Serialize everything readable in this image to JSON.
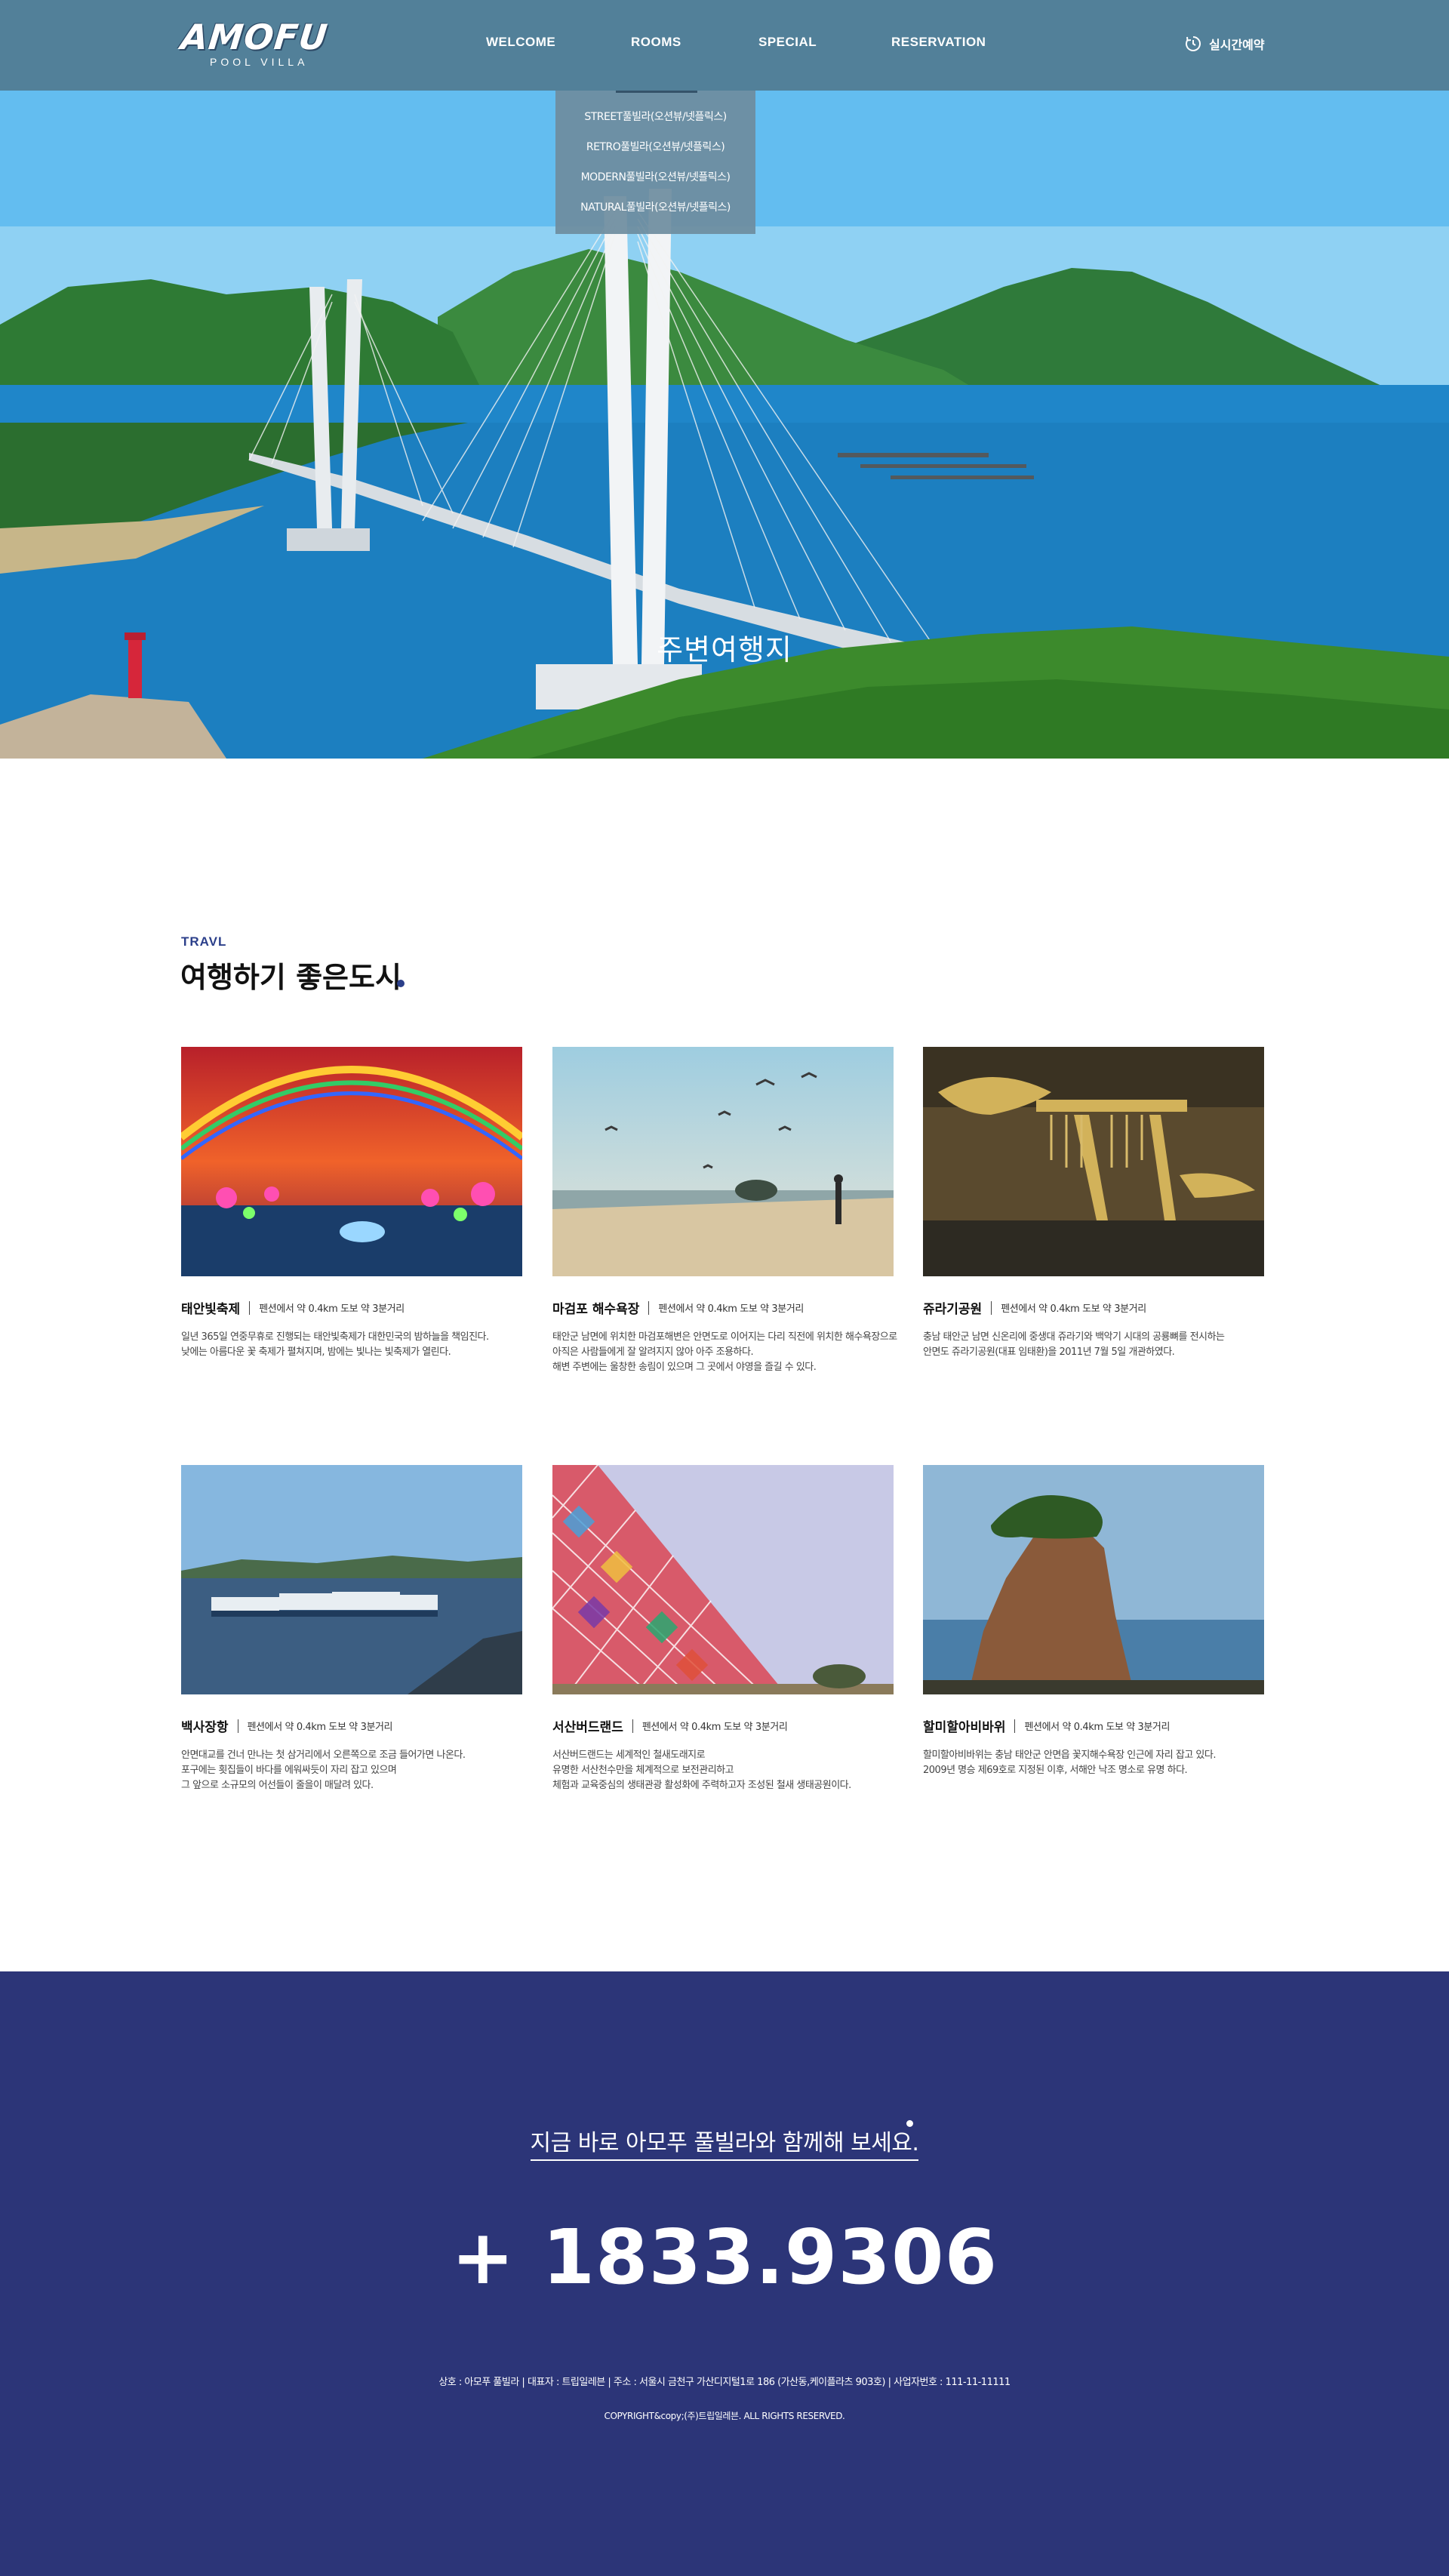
{
  "logo": {
    "main": "AMOFU",
    "sub": "POOL VILLA"
  },
  "nav": {
    "items": [
      {
        "label": "WELCOME"
      },
      {
        "label": "ROOMS"
      },
      {
        "label": "SPECIAL"
      },
      {
        "label": "RESERVATION"
      }
    ],
    "reservation_link": "실시간예약",
    "rooms_dropdown": [
      "STREET풀빌라(오션뷰/넷플릭스)",
      "RETRO풀빌라(오션뷰/넷플릭스)",
      "MODERN풀빌라(오션뷰/넷플릭스)",
      "NATURAL풀빌라(오션뷰/넷플릭스)"
    ]
  },
  "hero": {
    "caption": "주변여행지"
  },
  "section": {
    "label": "TRAVL",
    "title": "여행하기 좋은도시"
  },
  "cards": [
    {
      "name": "태안빛축제",
      "distance": "펜션에서 약 0.4km 도보 약 3분거리",
      "desc": [
        "일년 365일 연중무휴로 진행되는 태안빛축제가 대한민국의 밤하늘을 책임진다.",
        "낮에는 아름다운 꽃 축제가 펼쳐지며, 밤에는 빛나는 빛축제가 열린다."
      ]
    },
    {
      "name": "마검포 해수욕장",
      "distance": "펜션에서 약 0.4km 도보 약 3분거리",
      "desc": [
        "태안군 남면에 위치한 마검포해변은 안면도로 이어지는 다리 직전에 위치한 해수욕장으로",
        "아직은 사람들에게 잘 알려지지 않아 아주 조용하다.",
        "해변 주변에는 울창한 송림이 있으며 그 곳에서 야영을 즐길 수 있다."
      ]
    },
    {
      "name": "쥬라기공원",
      "distance": "펜션에서 약 0.4km 도보 약 3분거리",
      "desc": [
        "충남 태안군 남면 신온리에 중생대 쥬라기와 백악기 시대의 공룡뼈를 전시하는",
        "안면도 쥬라기공원(대표 임태환)을 2011년 7월 5일 개관하였다."
      ]
    },
    {
      "name": "백사장항",
      "distance": "펜션에서 약 0.4km 도보 약 3분거리",
      "desc": [
        "안면대교를 건너 만나는 첫 삼거리에서 오른쪽으로 조금 들어가면 나온다.",
        "포구에는 횟집들이 바다를 에워싸듯이 자리 잡고 있으며",
        "그 앞으로 소규모의 어선들이 줄을이 매달려 있다."
      ]
    },
    {
      "name": "서산버드랜드",
      "distance": "펜션에서 약 0.4km 도보 약 3분거리",
      "desc": [
        "서산버드랜드는 세계적인 철새도래지로",
        "유명한 서산천수만을 체계적으로 보전관리하고",
        "체험과 교육중심의 생태관광 활성화에 주력하고자 조성된 철새 생태공원이다."
      ]
    },
    {
      "name": "할미할아비바위",
      "distance": "펜션에서 약 0.4km 도보 약 3분거리",
      "desc": [
        "할미할아비바위는 충남 태안군 안면읍 꽃지해수욕장 인근에 자리 잡고 있다.",
        "2009년 명승 제69호로 지정된 이후, 서해안 낙조 명소로 유명 하다."
      ]
    }
  ],
  "footer": {
    "cta": "지금 바로 아모푸 풀빌라와 함께해 보세요.",
    "phone": "+ 1833.9306",
    "info": "상호 : 아모푸 풀빌라  |  대표자 : 트립일레븐  |  주소 : 서울시 금천구 가산디지털1로 186 (가산동,케이플라츠 903호)  |  사업자번호 : 111-11-11111",
    "copyright": "COPYRIGHT&copy;(주)트립일레븐. ALL RIGHTS RESERVED."
  }
}
